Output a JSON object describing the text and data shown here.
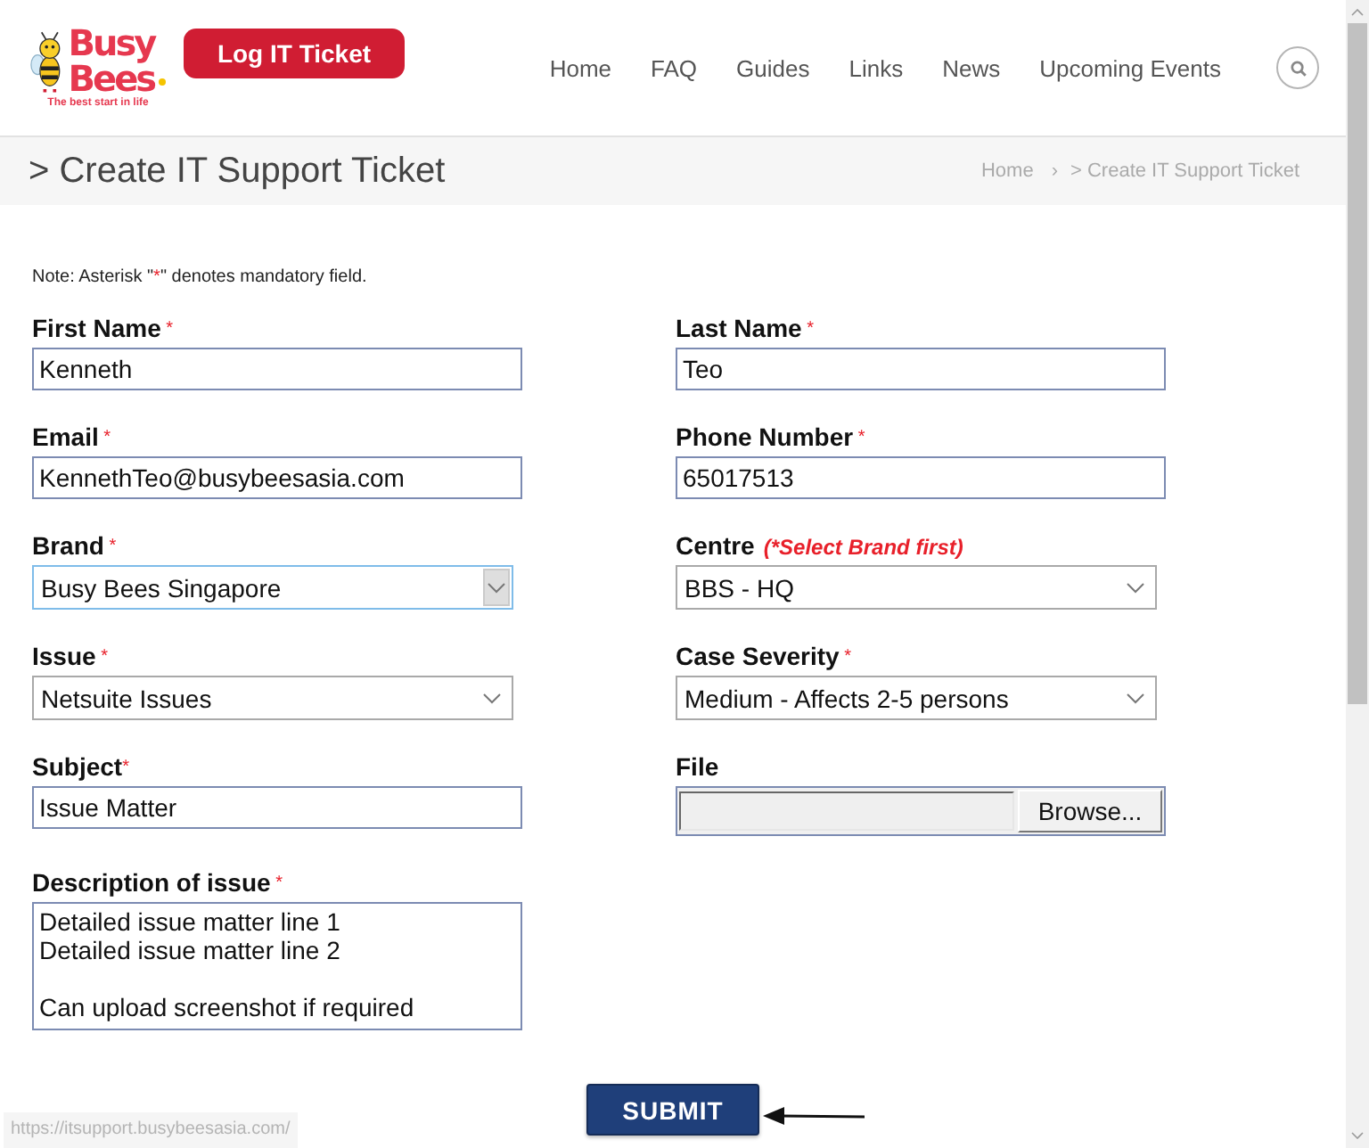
{
  "header": {
    "logo": {
      "lines": [
        "Busy",
        "Bees"
      ],
      "tagline": "The best start in life"
    },
    "action_button": "Log IT Ticket",
    "nav": [
      {
        "label": "Home",
        "selected": false
      },
      {
        "label": "FAQ",
        "selected": false
      },
      {
        "label": "Guides",
        "selected": false
      },
      {
        "label": "Links",
        "selected": false
      },
      {
        "label": "News",
        "selected": false
      },
      {
        "label": "Upcoming Events",
        "selected": false
      }
    ]
  },
  "title_bar": {
    "title": "> Create IT Support Ticket",
    "breadcrumb": [
      {
        "label": "Home"
      },
      {
        "label": "> Create IT Support Ticket"
      }
    ],
    "breadcrumb_separator": "›"
  },
  "form": {
    "note": {
      "before": "Note: Asterisk \"",
      "mark": "*",
      "after": "\" denotes mandatory field."
    },
    "fields": [
      {
        "kind": "text",
        "label": "First Name",
        "mark": " *",
        "value": "Kenneth",
        "focused": false
      },
      {
        "kind": "text",
        "label": "Last Name",
        "mark": " *",
        "value": "Teo",
        "focused": false
      },
      {
        "kind": "text",
        "label": "Email",
        "mark": " *",
        "value": "KennethTeo@busybeesasia.com",
        "focused": false
      },
      {
        "kind": "text",
        "label": "Phone Number",
        "mark": " *",
        "value": "65017513",
        "focused": false
      },
      {
        "kind": "select",
        "label": "Brand",
        "mark": " *",
        "value": "Busy Bees Singapore",
        "focused": true
      },
      {
        "kind": "select",
        "label": "Centre",
        "hint": "(*Select Brand first)",
        "value": "BBS - HQ",
        "focused": false
      },
      {
        "kind": "select",
        "label": "Issue",
        "mark": " *",
        "value": "Netsuite Issues",
        "focused": false
      },
      {
        "kind": "select",
        "label": "Case Severity",
        "mark": " *",
        "value": "Medium - Affects 2-5 persons",
        "focused": false
      },
      {
        "kind": "text",
        "label": "Subject",
        "mark": "*",
        "value": "Issue Matter",
        "focused": false
      },
      {
        "kind": "file",
        "label": "File",
        "button": "Browse...",
        "focused": false
      },
      {
        "kind": "textarea",
        "label": "Description of issue",
        "mark": " *",
        "value": "Detailed issue matter line 1\nDetailed issue matter line 2\n\nCan upload screenshot if required",
        "focused": false
      }
    ],
    "submit": "SUBMIT"
  },
  "status_url": "https://itsupport.busybeesasia.com/"
}
